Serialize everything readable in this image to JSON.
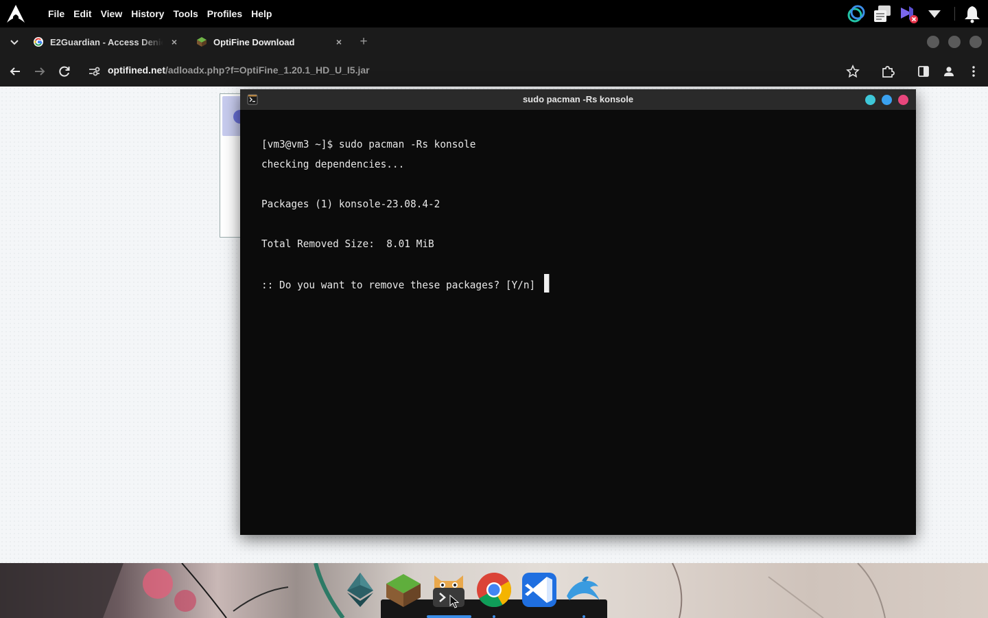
{
  "topbar": {
    "menus": [
      "File",
      "Edit",
      "View",
      "History",
      "Tools",
      "Profiles",
      "Help"
    ],
    "tray_icons": [
      "sync-icon",
      "clipboard-icon",
      "teams-icon",
      "dropdown-triangle-icon",
      "notification-bell-icon"
    ]
  },
  "browser": {
    "tabs": [
      {
        "title": "E2Guardian - Access Denied",
        "favicon": "google-icon",
        "active": false
      },
      {
        "title": "OptiFine Download",
        "favicon": "optifine-icon",
        "active": true
      }
    ],
    "new_tab_label": "+",
    "close_label": "×",
    "url": {
      "host": "optifined.net",
      "path": "/adloadx.php?f=OptiFine_1.20.1_HD_U_I5.jar"
    }
  },
  "terminal": {
    "title": "sudo pacman -Rs konsole",
    "lines": [
      "[vm3@vm3 ~]$ sudo pacman -Rs konsole",
      "checking dependencies...",
      "",
      "Packages (1) konsole-23.08.4-2",
      "",
      "Total Removed Size:  8.01 MiB",
      "",
      ":: Do you want to remove these packages? [Y/n] "
    ],
    "controls": {
      "minimize_color": "#3ec7d8",
      "maximize_color": "#3aa1f0",
      "close_color": "#e8467c"
    }
  },
  "dock": {
    "apps": [
      "ethereum-wallet-icon",
      "minecraft-grass-block-icon",
      "terminal-cat-icon",
      "chrome-icon",
      "vscode-icon",
      "dolphin-file-manager-icon"
    ]
  },
  "colors": {
    "accent_blue": "#3b8ee8",
    "terminal_bg": "#0b0b0b",
    "chrome_bg": "#1b1b1b"
  }
}
